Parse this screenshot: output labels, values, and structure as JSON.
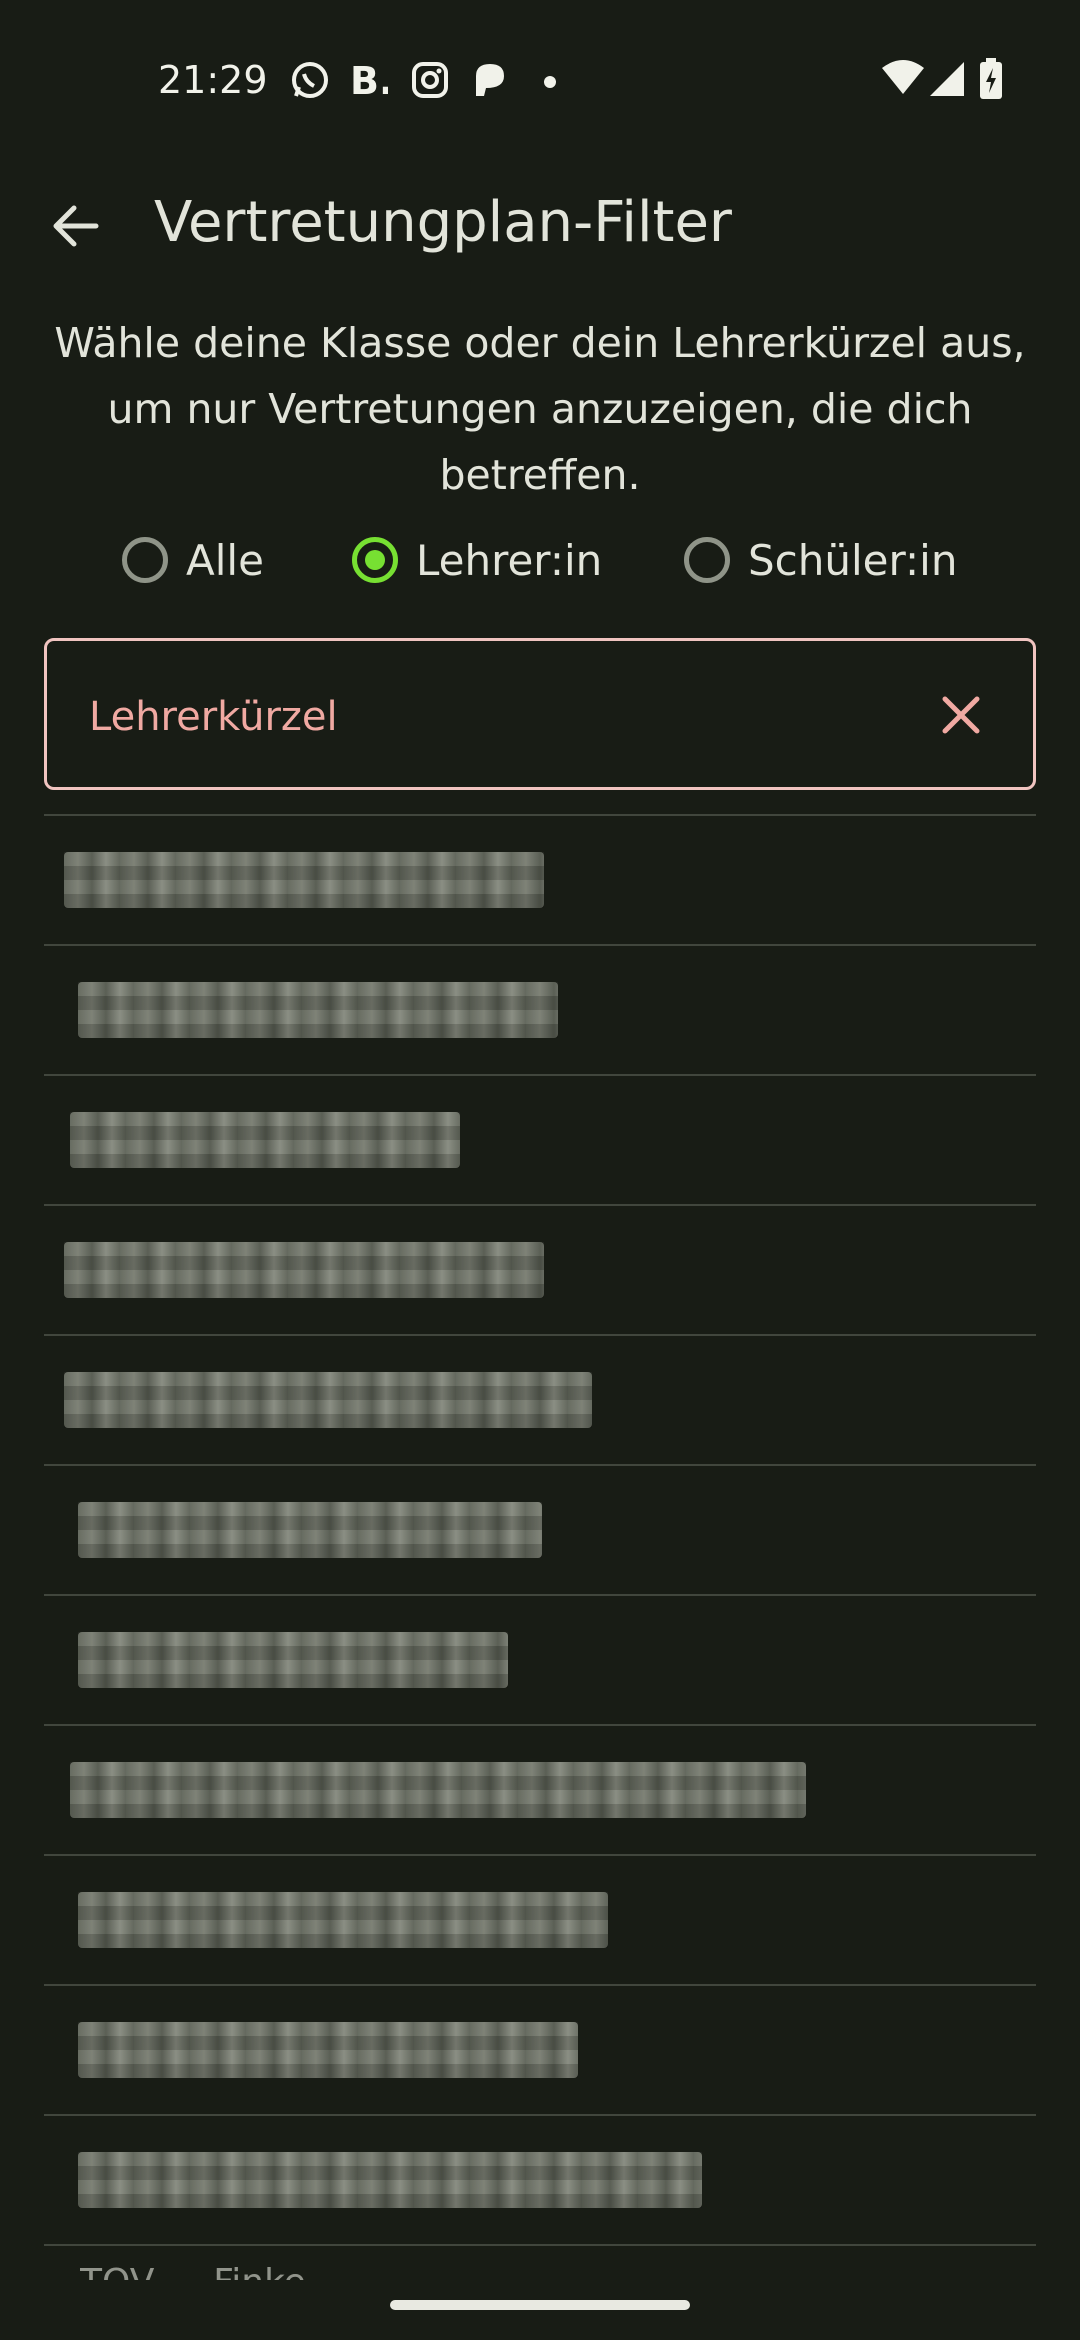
{
  "status_bar": {
    "time": "21:29",
    "notification_icons": [
      "whatsapp-icon",
      "booking-icon",
      "instagram-icon",
      "patreon-icon",
      "more-dot-icon"
    ],
    "system_icons": [
      "wifi-icon",
      "signal-icon",
      "battery-charging-icon"
    ]
  },
  "app_bar": {
    "title": "Vertretungplan-Filter",
    "back_icon": "arrow-back-icon"
  },
  "description": "Wähle deine Klasse oder dein Lehrerkürzel aus, um nur Vertretungen anzuzeigen, die dich betreffen.",
  "filter_options": {
    "all": "Alle",
    "teacher": "Lehrer:in",
    "student": "Schüler:in",
    "selected": "Lehrer:in"
  },
  "search_field": {
    "placeholder": "Lehrerkürzel",
    "value": "",
    "clear_icon": "close-icon"
  },
  "list": {
    "items": [
      "",
      "",
      "",
      "",
      "",
      "",
      "",
      "",
      "",
      "",
      "",
      ""
    ],
    "partial_item": "TOV — Finke"
  },
  "colors": {
    "background": "#181c15",
    "accent": "#77e032",
    "field_border": "#f0c4c0",
    "placeholder": "#f0a9a2"
  }
}
